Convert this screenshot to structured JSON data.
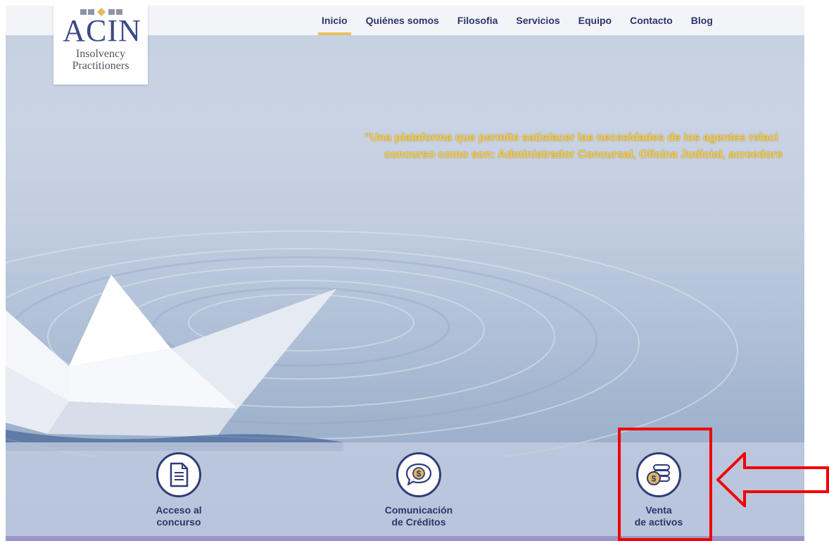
{
  "brand": {
    "logo_main": "ACIN",
    "logo_sub_line1": "Insolvency",
    "logo_sub_line2": "Practitioners"
  },
  "nav": {
    "items": [
      {
        "label": "Inicio",
        "active": true
      },
      {
        "label": "Quiénes somos"
      },
      {
        "label": "Filosofia"
      },
      {
        "label": "Servicios"
      },
      {
        "label": "Equipo"
      },
      {
        "label": "Contacto"
      },
      {
        "label": "Blog"
      }
    ]
  },
  "hero": {
    "tagline_line1": "\"Una plataforma que permite satisfacer las necesidades de los agentes relaci",
    "tagline_line2": "concurso como son: Administrador Concursal, Oficina Judicial, acreedore"
  },
  "features": [
    {
      "label": "Acceso al\nconcurso",
      "icon": "document-icon"
    },
    {
      "label": "Comunicación\nde Créditos",
      "icon": "coin-speech-bubble-icon"
    },
    {
      "label": "Venta\nde activos",
      "icon": "coins-stack-icon"
    }
  ],
  "colors": {
    "nav_text": "#2c3569",
    "nav_active_underline": "#e8c15a",
    "tagline": "#f1c94f",
    "icon_border": "#2f3d7a",
    "highlight": "#f20000"
  }
}
